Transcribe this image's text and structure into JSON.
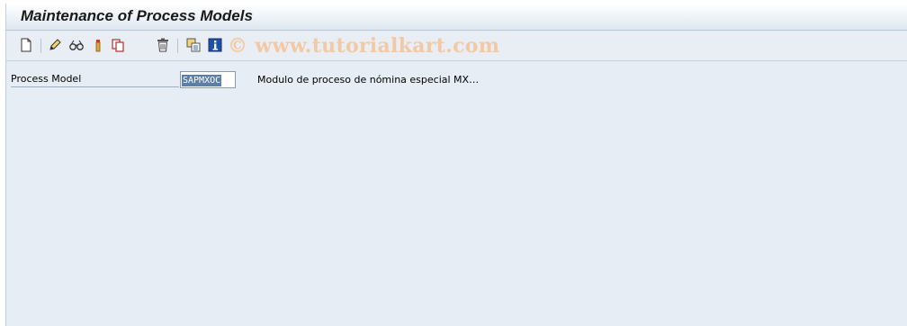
{
  "window": {
    "title": "Maintenance of Process Models"
  },
  "toolbar": {
    "buttons": [
      {
        "name": "create-icon"
      },
      {
        "name": "change-pencil-icon"
      },
      {
        "name": "display-glasses-icon"
      },
      {
        "name": "where-used-icon"
      },
      {
        "name": "copy-icon"
      },
      {
        "name": "delete-trash-icon"
      },
      {
        "name": "other-object-icon"
      },
      {
        "name": "information-icon"
      }
    ]
  },
  "watermark": {
    "text": "© www.tutorialkart.com"
  },
  "form": {
    "process_model_label": "Process Model",
    "process_model_value": "SAPMXOC",
    "process_model_description": "Modulo de proceso de nómina especial MX…"
  },
  "colors": {
    "background": "#e6edf5",
    "selection": "#5c7fa8",
    "watermark": "#f2c9a4"
  }
}
